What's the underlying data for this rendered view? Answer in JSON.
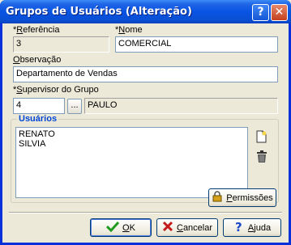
{
  "window": {
    "title": "Grupos de Usuários (Alteração)",
    "help_label": "?",
    "close_label": "✕"
  },
  "fields": {
    "referencia": {
      "label_prefix": "*",
      "label_key": "R",
      "label_rest": "eferência",
      "value": "3"
    },
    "nome": {
      "label_prefix": "*",
      "label_key": "N",
      "label_rest": "ome",
      "value": "COMERCIAL"
    },
    "observacao": {
      "label_key": "O",
      "label_rest": "bservação",
      "value": "Departamento de Vendas"
    },
    "supervisor": {
      "label_prefix": "*",
      "label_key": "S",
      "label_rest": "upervisor do Grupo",
      "code": "4",
      "lookup_label": "...",
      "name": "PAULO"
    }
  },
  "usuarios": {
    "title": "Usuários",
    "items": [
      "RENATO",
      "SILVIA"
    ]
  },
  "buttons": {
    "permissoes": {
      "key": "P",
      "rest": "ermissões"
    },
    "ok": {
      "key": "O",
      "rest": "K"
    },
    "cancelar": {
      "key": "C",
      "rest": "ancelar"
    },
    "ajuda": {
      "key": "A",
      "rest": "juda"
    }
  },
  "icons": [
    "new-document-icon",
    "trash-icon",
    "lock-icon",
    "check-icon",
    "cancel-x-icon",
    "help-question-icon"
  ],
  "colors": {
    "title_bar": "#0854e3",
    "group_title": "#0046d5",
    "face": "#ece9d8"
  }
}
